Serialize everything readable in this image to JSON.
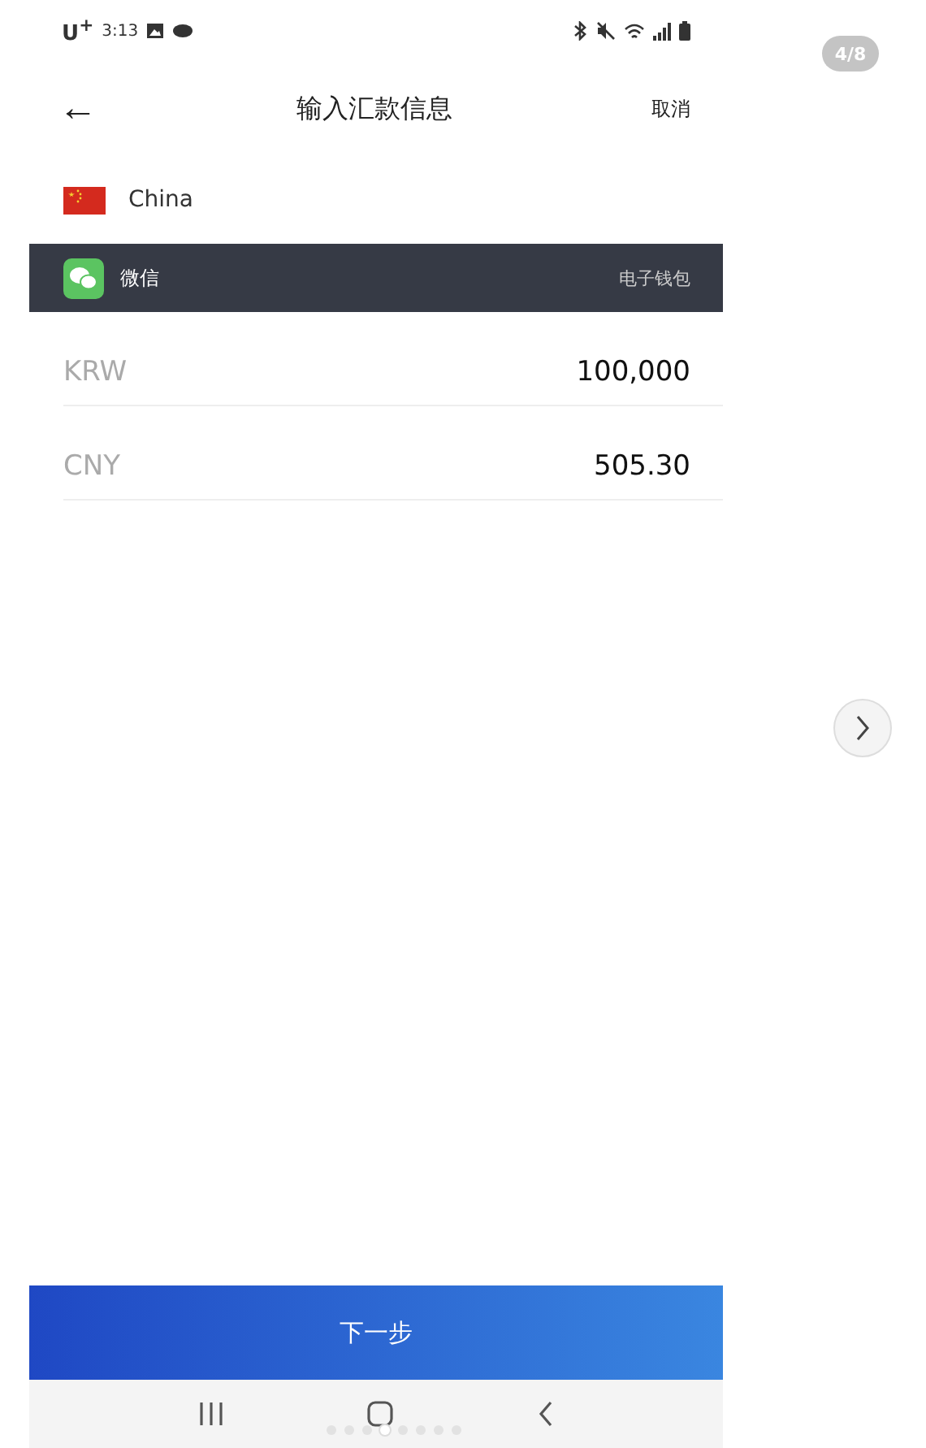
{
  "status_bar": {
    "carrier": "U$^{+}$",
    "time": "3:13"
  },
  "header": {
    "back": "←",
    "title": "输入汇款信息",
    "cancel": "取消"
  },
  "country": {
    "name": "China"
  },
  "method": {
    "name": "微信",
    "type": "电子钱包"
  },
  "amounts": [
    {
      "currency": "KRW",
      "value": "100,000"
    },
    {
      "currency": "CNY",
      "value": "505.30"
    }
  ],
  "next_button": "下一步",
  "gallery": {
    "counter": "4/8",
    "dots": [
      {
        "selected": false
      },
      {
        "selected": false
      },
      {
        "selected": false
      },
      {
        "selected": true
      },
      {
        "selected": false
      },
      {
        "selected": false
      },
      {
        "selected": false
      },
      {
        "selected": false
      }
    ]
  }
}
